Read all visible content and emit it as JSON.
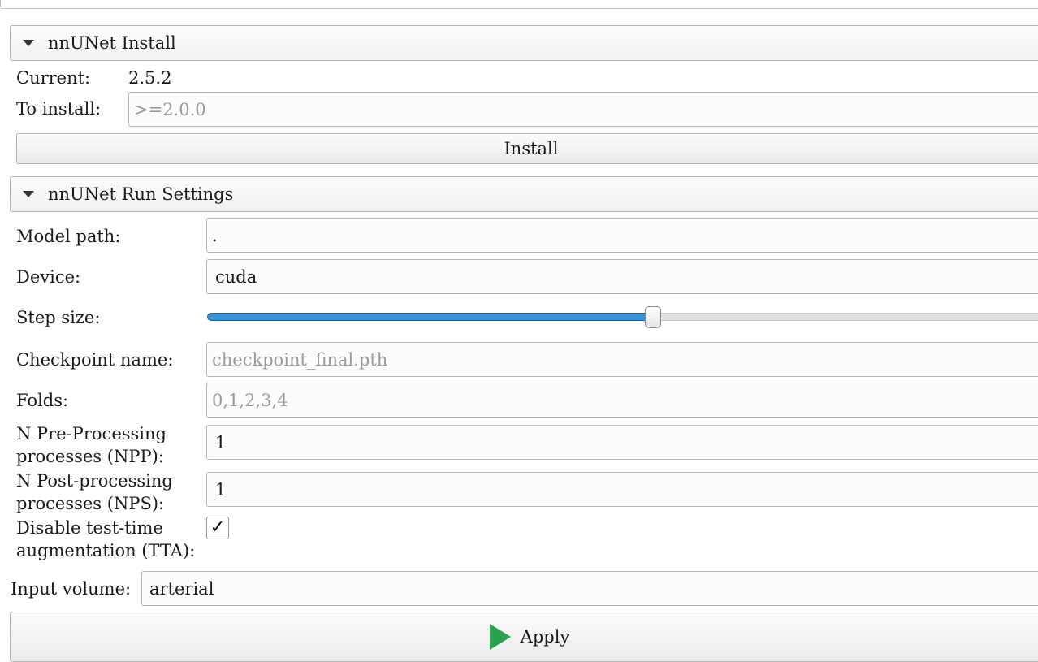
{
  "install_section": {
    "title": "nnUNet Install",
    "current_label": "Current:",
    "current_value": "2.5.2",
    "to_install_label": "To install:",
    "to_install_placeholder": ">=2.0.0",
    "install_button": "Install"
  },
  "run_section": {
    "title": "nnUNet Run Settings",
    "model_path_label": "Model path:",
    "model_path_value": ".",
    "device_label": "Device:",
    "device_value": "cuda",
    "step_size_label": "Step size:",
    "step_size_fraction": 0.5,
    "checkpoint_label": "Checkpoint name:",
    "checkpoint_placeholder": "checkpoint_final.pth",
    "folds_label": "Folds:",
    "folds_placeholder": "0,1,2,3,4",
    "npp_label_line1": "N Pre-Processing",
    "npp_label_line2": "processes (NPP):",
    "npp_value": "1",
    "nps_label_line1": "N Post-processing",
    "nps_label_line2": "processes (NPS):",
    "nps_value": "1",
    "tta_label_line1": "Disable test-time",
    "tta_label_line2": "augmentation (TTA):",
    "tta_checked": true,
    "tta_check_glyph": "✓"
  },
  "input_volume_label": "Input volume:",
  "input_volume_value": "arterial",
  "apply_button": "Apply"
}
